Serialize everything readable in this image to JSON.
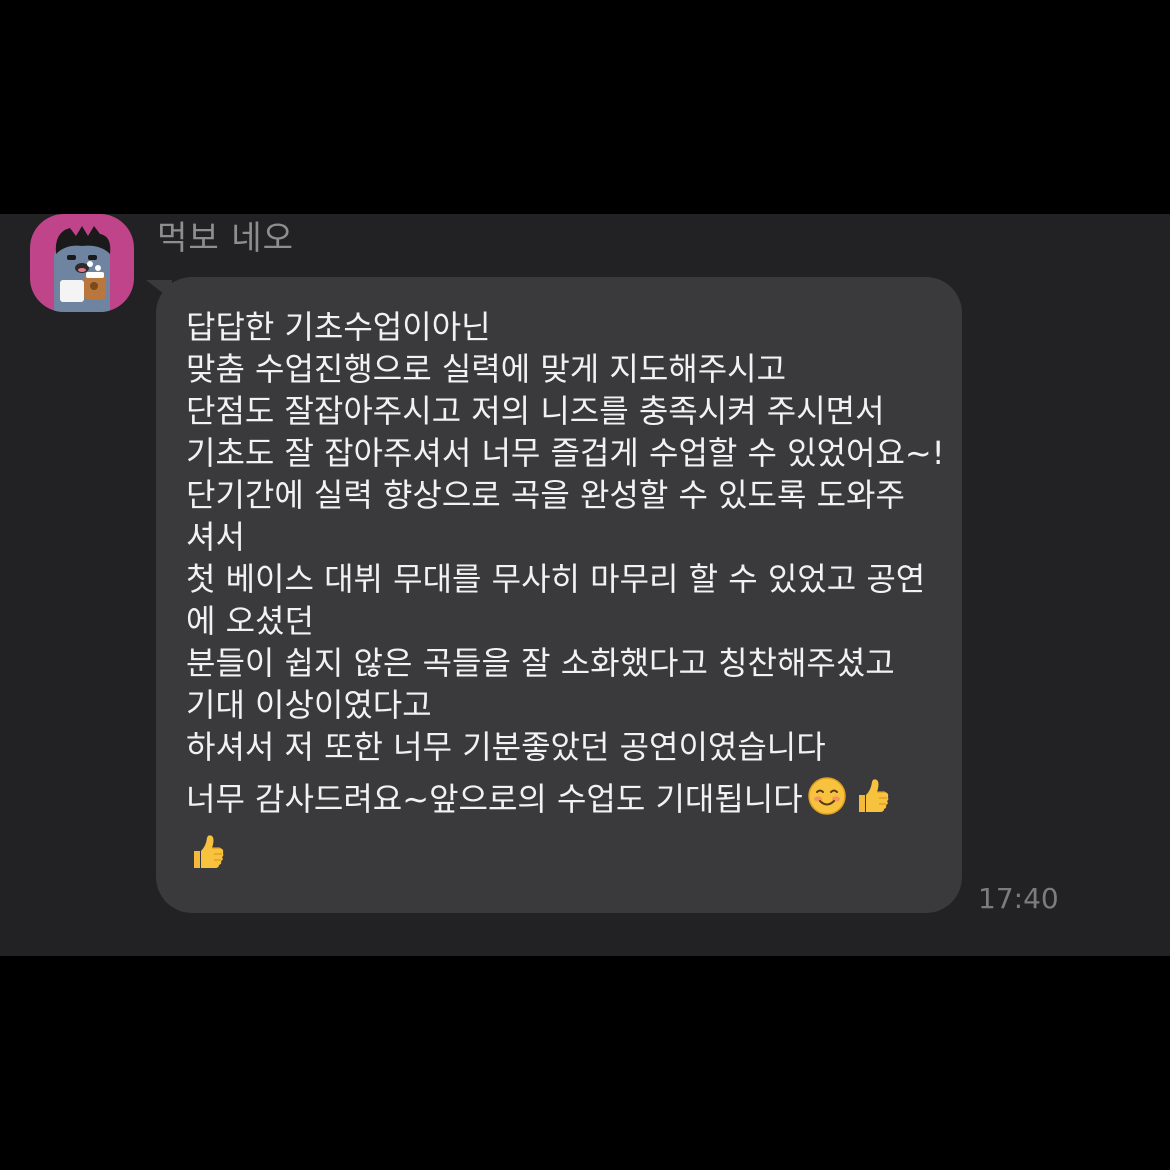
{
  "chat": {
    "sender_name": "먹보 네오",
    "avatar_icon": "neo-cat-character-icon",
    "avatar_color": "#c0448a",
    "timestamp": "17:40",
    "message": {
      "lines": [
        "답답한 기초수업이아닌",
        "맞춤 수업진행으로 실력에 맞게 지도해주시고",
        "단점도 잘잡아주시고 저의 니즈를 충족시켜 주시면서",
        "기초도 잘 잡아주셔서 너무 즐겁게 수업할 수 있었어요~!",
        "단기간에 실력 향상으로 곡을 완성할 수 있도록 도와주",
        "셔서",
        "첫 베이스 대뷔 무대를 무사히 마무리 할 수 있었고 공연",
        "에 오셨던",
        "분들이 쉽지 않은 곡들을 잘 소화했다고 칭찬해주셨고",
        "기대 이상이였다고",
        "하셔서 저 또한 너무 기분좋았던 공연이였습니다",
        "너무 감사드려요~앞으로의 수업도 기대됩니다"
      ],
      "trailing_emojis": [
        "smiling-face-icon",
        "thumbs-up-icon"
      ],
      "final_emoji": "thumbs-up-icon"
    }
  },
  "colors": {
    "screen_background": "#000000",
    "chat_background": "#222224",
    "bubble_background": "#3a3a3c",
    "message_text": "#f2f2f2",
    "sender_text": "#8e8e90",
    "timestamp_text": "#7c7c7e"
  }
}
